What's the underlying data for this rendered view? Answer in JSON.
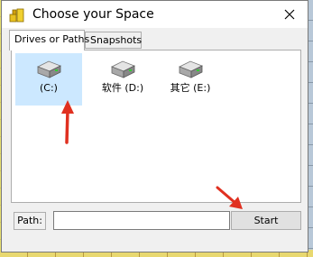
{
  "window": {
    "title": "Choose your Space"
  },
  "tabs": [
    {
      "label": "Drives or Paths",
      "active": true
    },
    {
      "label": "Snapshots",
      "active": false
    }
  ],
  "drives": [
    {
      "label": "(C:)",
      "selected": true,
      "icon": "hard-drive-icon"
    },
    {
      "label": "软件 (D:)",
      "selected": false,
      "icon": "hard-drive-icon"
    },
    {
      "label": "其它 (E:)",
      "selected": false,
      "icon": "hard-drive-icon"
    }
  ],
  "path": {
    "label": "Path:",
    "value": "",
    "placeholder": ""
  },
  "start_button": {
    "label": "Start"
  },
  "colors": {
    "selection": "#cce8ff",
    "annotation_arrow": "#e03020"
  }
}
